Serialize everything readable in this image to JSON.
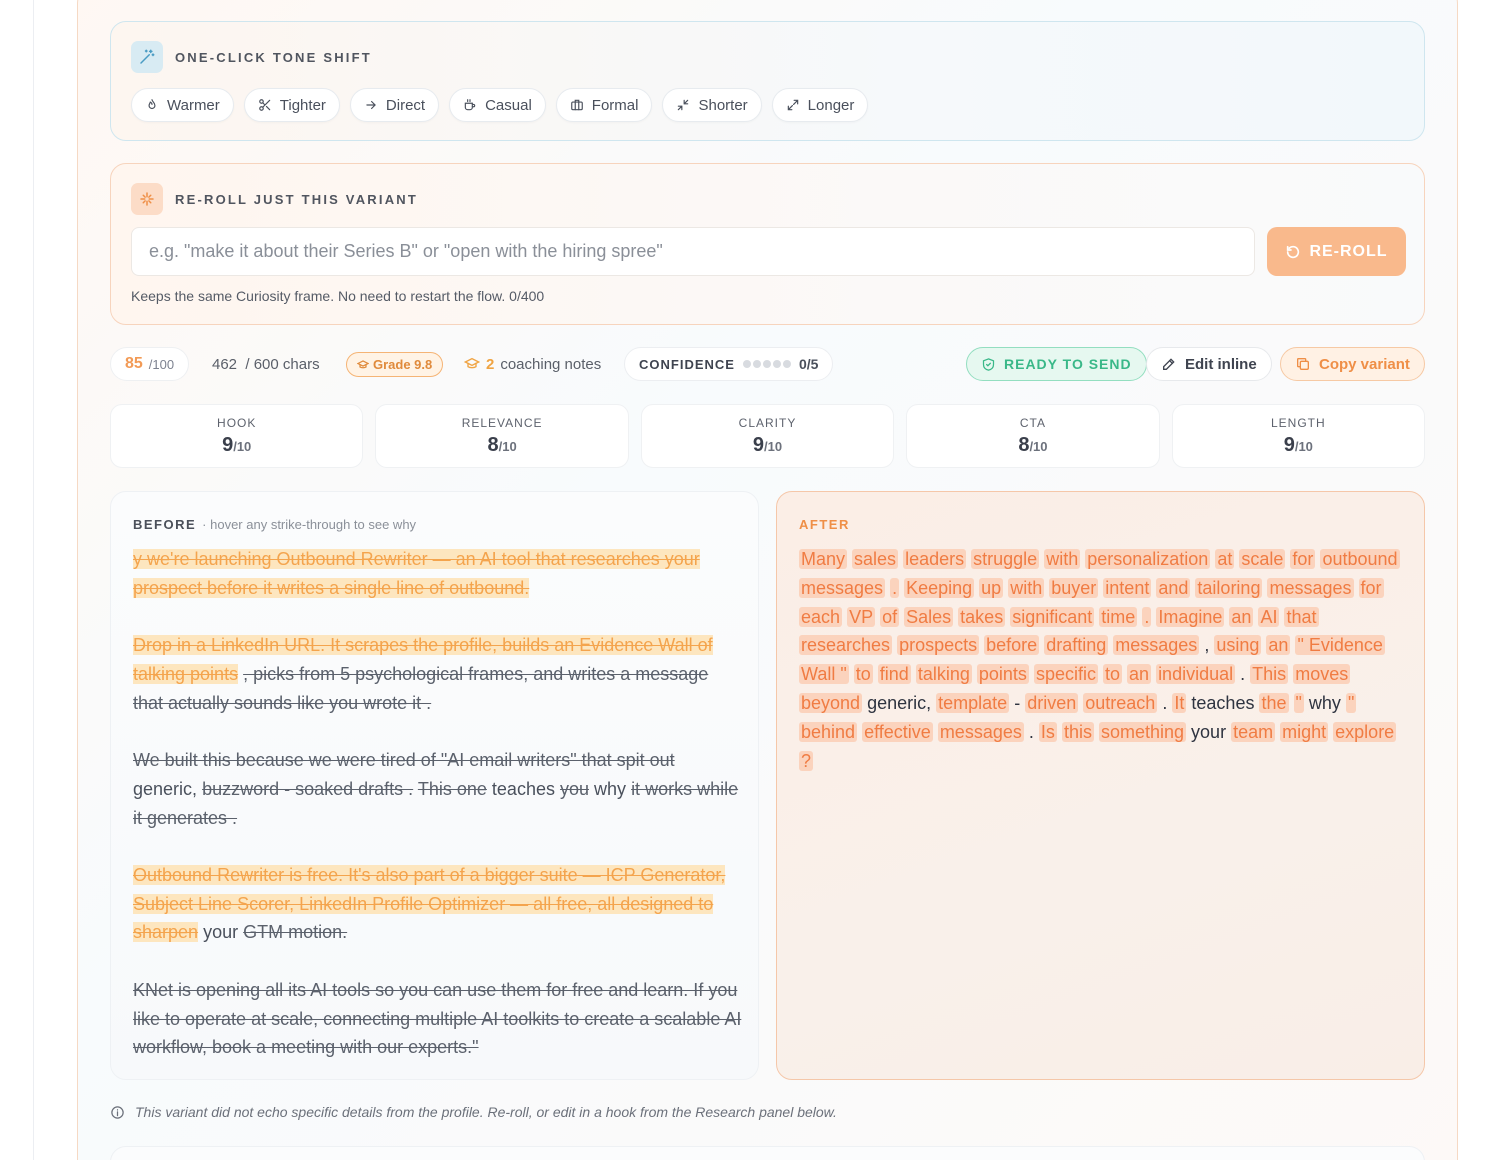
{
  "tone_shift": {
    "title": "ONE-CLICK TONE SHIFT",
    "chips": [
      {
        "label": "Warmer",
        "icon": "flame-icon"
      },
      {
        "label": "Tighter",
        "icon": "scissors-icon"
      },
      {
        "label": "Direct",
        "icon": "arrow-right-icon"
      },
      {
        "label": "Casual",
        "icon": "coffee-icon"
      },
      {
        "label": "Formal",
        "icon": "briefcase-icon"
      },
      {
        "label": "Shorter",
        "icon": "shrink-icon"
      },
      {
        "label": "Longer",
        "icon": "expand-icon"
      }
    ]
  },
  "reroll": {
    "title": "RE-ROLL JUST THIS VARIANT",
    "placeholder": "e.g. \"make it about their Series B\" or \"open with the hiring spree\"",
    "button_label": "RE-ROLL",
    "hint": "Keeps the same Curiosity frame. No need to restart the flow. 0/400"
  },
  "stats": {
    "score": "85",
    "score_max": "/100",
    "chars": "462",
    "chars_max": "/ 600 chars",
    "grade": "Grade 9.8",
    "coaching_count": "2",
    "coaching_label": "coaching notes",
    "confidence_label": "CONFIDENCE",
    "confidence_value": "0/5",
    "confidence_level": 0,
    "ready_label": "READY TO SEND",
    "edit_label": "Edit inline",
    "copy_label": "Copy variant"
  },
  "metrics": [
    {
      "label": "HOOK",
      "value": "9",
      "max": "/10"
    },
    {
      "label": "RELEVANCE",
      "value": "8",
      "max": "/10"
    },
    {
      "label": "CLARITY",
      "value": "9",
      "max": "/10"
    },
    {
      "label": "CTA",
      "value": "8",
      "max": "/10"
    },
    {
      "label": "LENGTH",
      "value": "9",
      "max": "/10"
    }
  ],
  "before": {
    "title": "BEFORE",
    "subtitle": "· hover any strike-through to see why",
    "p1_hl": "y we're launching Outbound Rewriter — an AI tool that researches your prospect before it writes a single line of outbound.",
    "p2_hl": "Drop in a LinkedIn URL. It scrapes the profile, builds an Evidence Wall of talking points",
    "p2_del": ", picks from 5 psychological frames, and writes a message that actually sounds like you wrote it .",
    "p3_del1": "We built this because we were tired of \"AI email writers\" that spit out",
    "p3_keep1": "generic,",
    "p3_del2": "buzzword - soaked drafts .",
    "p3_del3": "This one",
    "p3_keep2": "teaches",
    "p3_del4": "you",
    "p3_keep3": "why",
    "p3_del5": "it works while it generates .",
    "p4_hl": "Outbound Rewriter is free. It's also part of a bigger suite — ICP Generator, Subject Line Scorer, LinkedIn Profile Optimizer — all free, all designed to sharpen",
    "p4_keep": "your",
    "p4_del": "GTM motion.",
    "p5_del": "KNet is opening all its AI tools so you can use them for free and learn. If you like to operate at scale, connecting multiple AI toolkits to create a scalable AI workflow, book a meeting with our experts.\""
  },
  "after": {
    "title": "AFTER",
    "tokens": [
      {
        "t": "Many",
        "ins": true
      },
      {
        "t": "sales",
        "ins": true
      },
      {
        "t": "leaders",
        "ins": true
      },
      {
        "t": "struggle",
        "ins": true
      },
      {
        "t": "with",
        "ins": true
      },
      {
        "t": "personalization",
        "ins": true
      },
      {
        "t": "at",
        "ins": true
      },
      {
        "t": "scale",
        "ins": true
      },
      {
        "t": "for",
        "ins": true
      },
      {
        "t": "outbound",
        "ins": true
      },
      {
        "t": "messages",
        "ins": true
      },
      {
        "t": ".",
        "ins": true
      },
      {
        "t": "Keeping",
        "ins": true
      },
      {
        "t": "up",
        "ins": true
      },
      {
        "t": "with",
        "ins": true
      },
      {
        "t": "buyer",
        "ins": true
      },
      {
        "t": "intent",
        "ins": true
      },
      {
        "t": "and",
        "ins": true
      },
      {
        "t": "tailoring",
        "ins": true
      },
      {
        "t": "messages",
        "ins": true
      },
      {
        "t": "for",
        "ins": true
      },
      {
        "t": "each",
        "ins": true
      },
      {
        "t": "VP",
        "ins": true
      },
      {
        "t": "of",
        "ins": true
      },
      {
        "t": "Sales",
        "ins": true
      },
      {
        "t": "takes",
        "ins": true
      },
      {
        "t": "significant",
        "ins": true
      },
      {
        "t": "time",
        "ins": true
      },
      {
        "t": ".",
        "ins": true
      },
      {
        "t": "Imagine",
        "ins": true
      },
      {
        "t": "an",
        "ins": true
      },
      {
        "t": "AI",
        "ins": true
      },
      {
        "t": "that",
        "ins": true
      },
      {
        "t": "researches",
        "ins": true
      },
      {
        "t": "prospects",
        "ins": true
      },
      {
        "t": "before",
        "ins": true
      },
      {
        "t": "drafting",
        "ins": true
      },
      {
        "t": "messages",
        "ins": true
      },
      {
        "t": ",",
        "ins": false
      },
      {
        "t": "using",
        "ins": true
      },
      {
        "t": "an",
        "ins": true
      },
      {
        "t": "\" Evidence",
        "ins": true
      },
      {
        "t": "Wall \"",
        "ins": true
      },
      {
        "t": "to",
        "ins": true
      },
      {
        "t": "find",
        "ins": true
      },
      {
        "t": "talking",
        "ins": true
      },
      {
        "t": "points",
        "ins": true
      },
      {
        "t": "specific",
        "ins": true
      },
      {
        "t": "to",
        "ins": true
      },
      {
        "t": "an",
        "ins": true
      },
      {
        "t": "individual",
        "ins": true
      },
      {
        "t": ".",
        "ins": false
      },
      {
        "t": "This",
        "ins": true
      },
      {
        "t": "moves",
        "ins": true
      },
      {
        "t": "beyond",
        "ins": true
      },
      {
        "t": "generic,",
        "ins": false
      },
      {
        "t": "template",
        "ins": true
      },
      {
        "t": "-",
        "ins": false
      },
      {
        "t": "driven",
        "ins": true
      },
      {
        "t": "outreach",
        "ins": true
      },
      {
        "t": ".",
        "ins": false
      },
      {
        "t": "It",
        "ins": true
      },
      {
        "t": "teaches",
        "ins": false
      },
      {
        "t": "the",
        "ins": true
      },
      {
        "t": "\"",
        "ins": true
      },
      {
        "t": "why",
        "ins": false
      },
      {
        "t": "\"",
        "ins": true
      },
      {
        "t": "behind",
        "ins": true
      },
      {
        "t": "effective",
        "ins": true
      },
      {
        "t": "messages",
        "ins": true
      },
      {
        "t": ".",
        "ins": false
      },
      {
        "t": "Is",
        "ins": true
      },
      {
        "t": "this",
        "ins": true
      },
      {
        "t": "something",
        "ins": true
      },
      {
        "t": "your",
        "ins": false
      },
      {
        "t": "team",
        "ins": true
      },
      {
        "t": "might",
        "ins": true
      },
      {
        "t": "explore",
        "ins": true
      },
      {
        "t": "?",
        "ins": true
      }
    ]
  },
  "footer_note": "This variant did not echo specific details from the profile. Re-roll, or edit in a hook from the Research panel below.",
  "colors": {
    "accent_orange": "#f29a55",
    "ready_green": "#39b888",
    "insert_bg": "#fbd3bd",
    "delete_highlight": "#fde6bf"
  }
}
